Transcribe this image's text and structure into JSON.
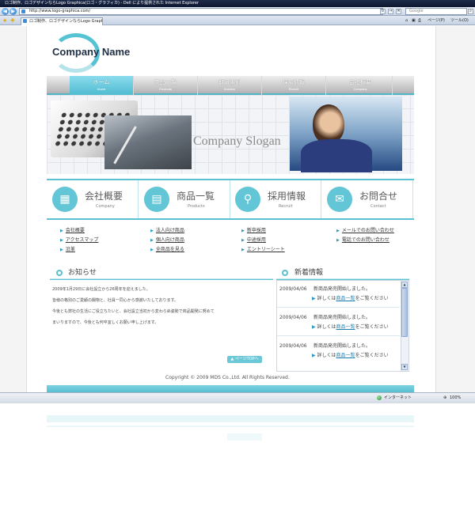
{
  "browser": {
    "window_title": "ロゴ制作、ロゴデザインならLogo Graphica(ロゴ・グラフィカ) - Dell により提供された Internet Explorer",
    "url": "http://www.logo-graphica.com/",
    "search_placeholder": "Google",
    "tab_title": "ロゴ制作、ロゴデザインならLogo Graphica(ロ...",
    "tools_page": "ページ(P)",
    "tools_tools": "ツール(O)",
    "status_zone": "インターネット",
    "zoom": "100%"
  },
  "logo": {
    "name": "Company Name"
  },
  "nav": [
    {
      "jp": "ホーム",
      "en": "Home",
      "active": true
    },
    {
      "jp": "商品一覧",
      "en": "Products",
      "active": false
    },
    {
      "jp": "取引事例",
      "en": "Solution",
      "active": false
    },
    {
      "jp": "採用情報",
      "en": "Recruit",
      "active": false
    },
    {
      "jp": "会社概要",
      "en": "Company",
      "active": false
    }
  ],
  "hero": {
    "slogan": "Company Slogan"
  },
  "categories": [
    {
      "jp": "会社概要",
      "en": "Company",
      "icon": "building-icon",
      "glyph": "▦"
    },
    {
      "jp": "商品一覧",
      "en": "Products",
      "icon": "catalog-icon",
      "glyph": "▤"
    },
    {
      "jp": "採用情報",
      "en": "Recruit",
      "icon": "sprout-icon",
      "glyph": "⚲"
    },
    {
      "jp": "お問合せ",
      "en": "Contact",
      "icon": "mail-icon",
      "glyph": "✉"
    }
  ],
  "links": [
    [
      "会社概要",
      "アクセスマップ",
      "沿革"
    ],
    [
      "法人向け商品",
      "個人向け商品",
      "全商品を見る"
    ],
    [
      "新卒採用",
      "中途採用",
      "エントリーシート"
    ],
    [
      "メールでのお問い合わせ",
      "電話でのお問い合わせ"
    ]
  ],
  "notice": {
    "title": "お知らせ",
    "lines": [
      "2009年1月29日に会社設立から26周年を迎えました。",
      "皆様の格別のご愛顧の賜物と、社員一同心から感謝いたしております。",
      "今後とも弊社の生活にご役立ちたいと、会社設立当初から変わらぬ姿勢で商品開発に努めて",
      "まいりますので、今後とも何卒宜しくお願い申し上げます。"
    ],
    "pagetop": "ページTOPへ"
  },
  "news": {
    "title": "新着情報",
    "items": [
      {
        "date": "2009/04/06",
        "title": "新商品発売開始しました。",
        "prefix": "詳しくは",
        "link": "商品一覧",
        "suffix": "をご覧ください"
      },
      {
        "date": "2009/04/06",
        "title": "新商品発売開始しました。",
        "prefix": "詳しくは",
        "link": "商品一覧",
        "suffix": "をご覧ください"
      },
      {
        "date": "2009/04/06",
        "title": "新商品発売開始しました。",
        "prefix": "詳しくは",
        "link": "商品一覧",
        "suffix": "をご覧ください"
      }
    ]
  },
  "footer": {
    "copyright": "Copyright ©  2009 MDS Co.,Ltd. All Rights Reserved."
  },
  "colors": {
    "accent": "#5cc1d2",
    "nav_active": "#4fbbd0",
    "text": "#444444"
  }
}
